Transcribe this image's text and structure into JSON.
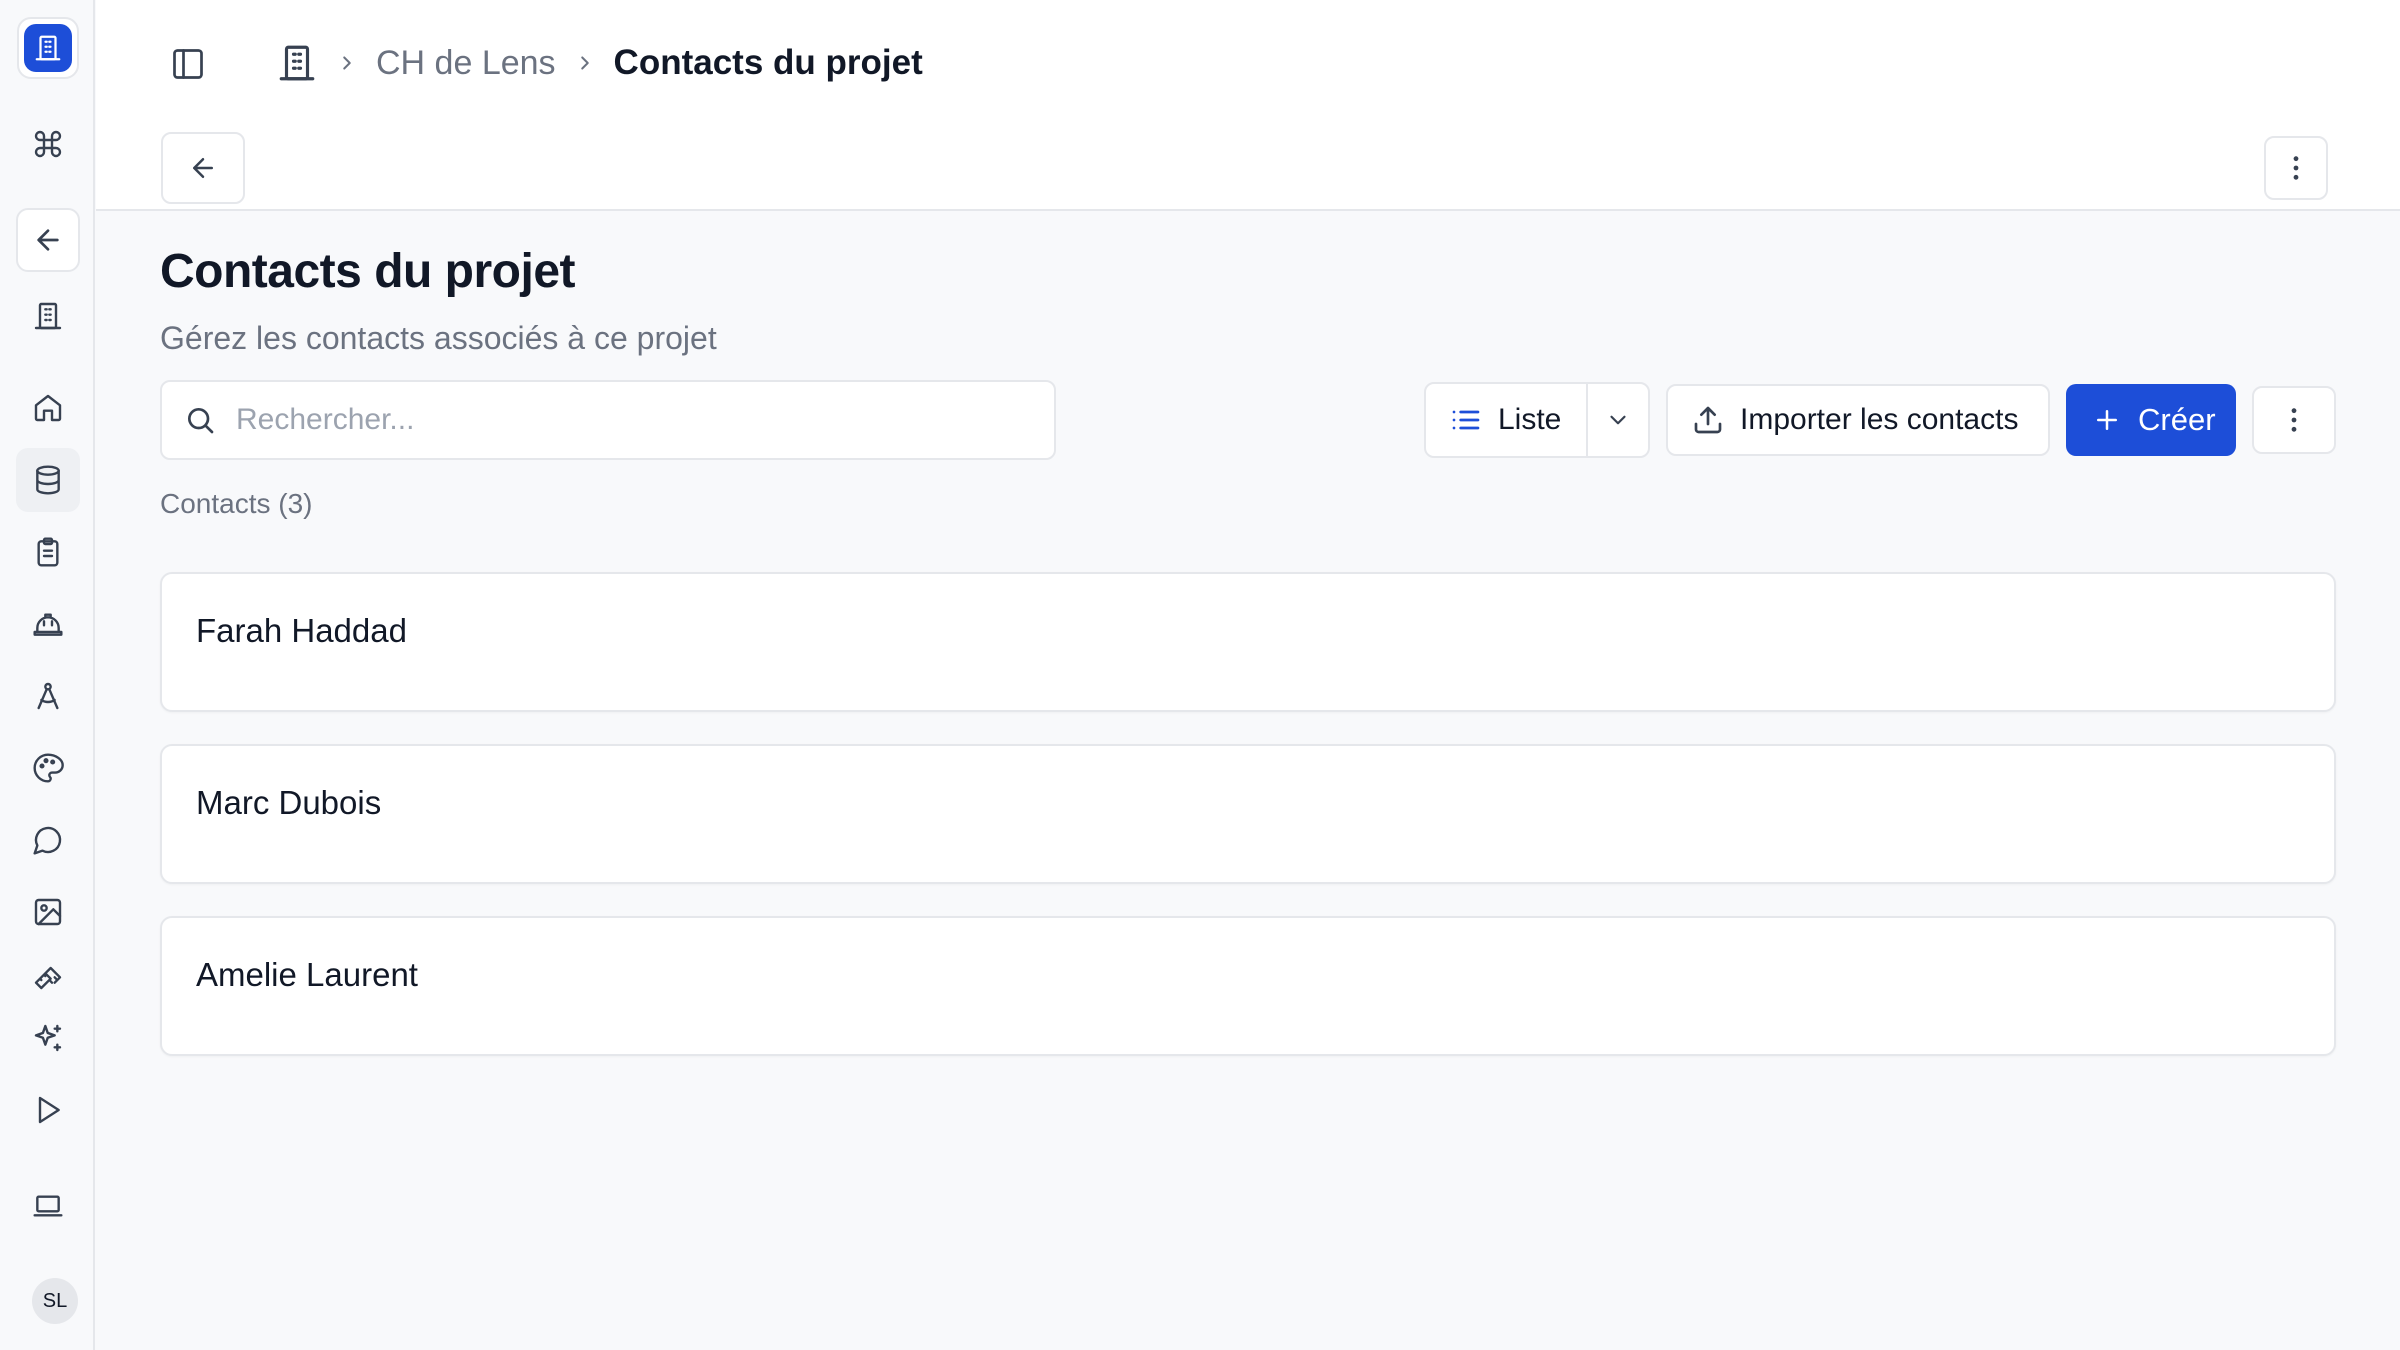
{
  "sidebar": {
    "avatar_initials": "SL",
    "items": [
      {
        "icon": "command-icon"
      },
      {
        "icon": "arrow-left-icon"
      },
      {
        "icon": "building-icon"
      },
      {
        "icon": "home-icon"
      },
      {
        "icon": "database-icon"
      },
      {
        "icon": "clipboard-icon"
      },
      {
        "icon": "hard-hat-icon"
      },
      {
        "icon": "compass-icon"
      },
      {
        "icon": "palette-icon"
      },
      {
        "icon": "message-circle-icon"
      },
      {
        "icon": "image-icon"
      },
      {
        "icon": "ruler-icon"
      },
      {
        "icon": "sparkles-icon"
      },
      {
        "icon": "play-icon"
      },
      {
        "icon": "laptop-icon"
      }
    ]
  },
  "breadcrumb": {
    "parent": "CH de Lens",
    "current": "Contacts du projet"
  },
  "page": {
    "title": "Contacts du projet",
    "subtitle": "Gérez les contacts associés à ce projet"
  },
  "toolbar": {
    "search_placeholder": "Rechercher...",
    "search_value": "",
    "view_label": "Liste",
    "import_label": "Importer les contacts",
    "create_label": "Créer"
  },
  "contacts": {
    "count_label": "Contacts (3)",
    "items": [
      {
        "name": "Farah Haddad"
      },
      {
        "name": "Marc Dubois"
      },
      {
        "name": "Amelie Laurent"
      }
    ]
  },
  "colors": {
    "accent": "#1d4ed8",
    "background": "#f8f9fb",
    "border": "#e5e7eb",
    "muted_text": "#6b7280"
  }
}
